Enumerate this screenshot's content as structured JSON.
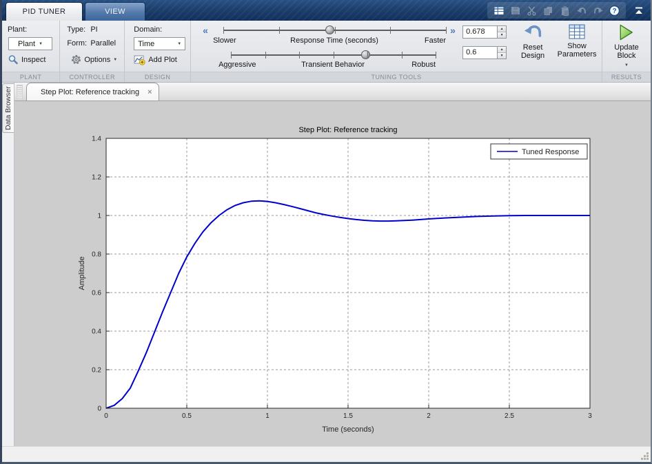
{
  "glyphs": {
    "dropdown": "▼",
    "spin_up": "▲",
    "spin_down": "▼",
    "chevron_left": "«",
    "chevron_right": "»",
    "help": "?"
  },
  "titlebar": {
    "tab_pid_tuner": "PID TUNER",
    "tab_view": "VIEW",
    "qat_icons": [
      "layout-icon",
      "save-icon",
      "cut-icon",
      "copy-icon",
      "paste-icon",
      "undo-icon",
      "redo-icon",
      "help-icon",
      "collapse-toolstrip-icon"
    ]
  },
  "ribbon": {
    "plant": {
      "section_label": "PLANT",
      "field_label": "Plant:",
      "dropdown_value": "Plant",
      "inspect_label": "Inspect"
    },
    "controller": {
      "section_label": "CONTROLLER",
      "type_label": "Type:",
      "type_value": "PI",
      "form_label": "Form:",
      "form_value": "Parallel",
      "options_label": "Options"
    },
    "design": {
      "section_label": "DESIGN",
      "domain_label": "Domain:",
      "domain_value": "Time",
      "add_plot_label": "Add Plot"
    },
    "tuning_tools": {
      "section_label": "TUNING TOOLS",
      "response_slider": {
        "left_label": "Slower",
        "center_label": "Response Time (seconds)",
        "right_label": "Faster",
        "handle_pct": 48,
        "tick_count": 5
      },
      "transient_slider": {
        "left_label": "Aggressive",
        "center_label": "Transient Behavior",
        "right_label": "Robust",
        "handle_pct": 66,
        "tick_count": 7
      },
      "response_value": "0.678",
      "transient_value": "0.6",
      "reset_button": {
        "line1": "Reset",
        "line2": "Design"
      },
      "show_parameters_button": {
        "line1": "Show",
        "line2": "Parameters"
      }
    },
    "results": {
      "section_label": "RESULTS",
      "update_button": {
        "line1": "Update",
        "line2": "Block"
      }
    }
  },
  "sidebar": {
    "label": "Data Browser"
  },
  "document_tab": {
    "label": "Step Plot: Reference tracking",
    "close_glyph": "×"
  },
  "chart_data": {
    "type": "line",
    "title": "Step Plot: Reference tracking",
    "xlabel": "Time (seconds)",
    "ylabel": "Amplitude",
    "xlim": [
      0,
      3
    ],
    "ylim": [
      0,
      1.4
    ],
    "xticks": [
      0,
      0.5,
      1,
      1.5,
      2,
      2.5,
      3
    ],
    "xtick_labels": [
      "0",
      "0.5",
      "1",
      "1.5",
      "2",
      "2.5",
      "3"
    ],
    "yticks": [
      0,
      0.2,
      0.4,
      0.6,
      0.8,
      1,
      1.2,
      1.4
    ],
    "ytick_labels": [
      "0",
      "0.2",
      "0.4",
      "0.6",
      "0.8",
      "1",
      "1.2",
      "1.4"
    ],
    "grid": true,
    "legend": {
      "position": "northeast",
      "entries": [
        "Tuned Response"
      ]
    },
    "colors": {
      "line": "#0000cc",
      "grid": "#9a9a9a",
      "axes_box": "#262626",
      "plot_background": "#ffffff"
    },
    "series": [
      {
        "name": "Tuned Response",
        "x": [
          0,
          0.05,
          0.1,
          0.15,
          0.2,
          0.25,
          0.3,
          0.35,
          0.4,
          0.45,
          0.5,
          0.55,
          0.6,
          0.65,
          0.7,
          0.75,
          0.8,
          0.85,
          0.9,
          0.95,
          1.0,
          1.05,
          1.1,
          1.15,
          1.2,
          1.25,
          1.3,
          1.35,
          1.4,
          1.45,
          1.5,
          1.55,
          1.6,
          1.65,
          1.7,
          1.75,
          1.8,
          1.85,
          1.9,
          1.95,
          2.0,
          2.1,
          2.2,
          2.3,
          2.4,
          2.5,
          2.6,
          2.7,
          2.8,
          2.9,
          3.0
        ],
        "y": [
          0,
          0.015,
          0.05,
          0.105,
          0.195,
          0.29,
          0.395,
          0.5,
          0.6,
          0.7,
          0.785,
          0.855,
          0.915,
          0.962,
          1.0,
          1.03,
          1.052,
          1.066,
          1.074,
          1.076,
          1.073,
          1.066,
          1.057,
          1.047,
          1.036,
          1.025,
          1.014,
          1.005,
          0.997,
          0.99,
          0.984,
          0.979,
          0.975,
          0.972,
          0.971,
          0.971,
          0.972,
          0.974,
          0.976,
          0.979,
          0.982,
          0.987,
          0.991,
          0.995,
          0.997,
          0.999,
          1.0,
          1.0,
          1.0,
          1.0,
          1.0
        ]
      }
    ]
  }
}
